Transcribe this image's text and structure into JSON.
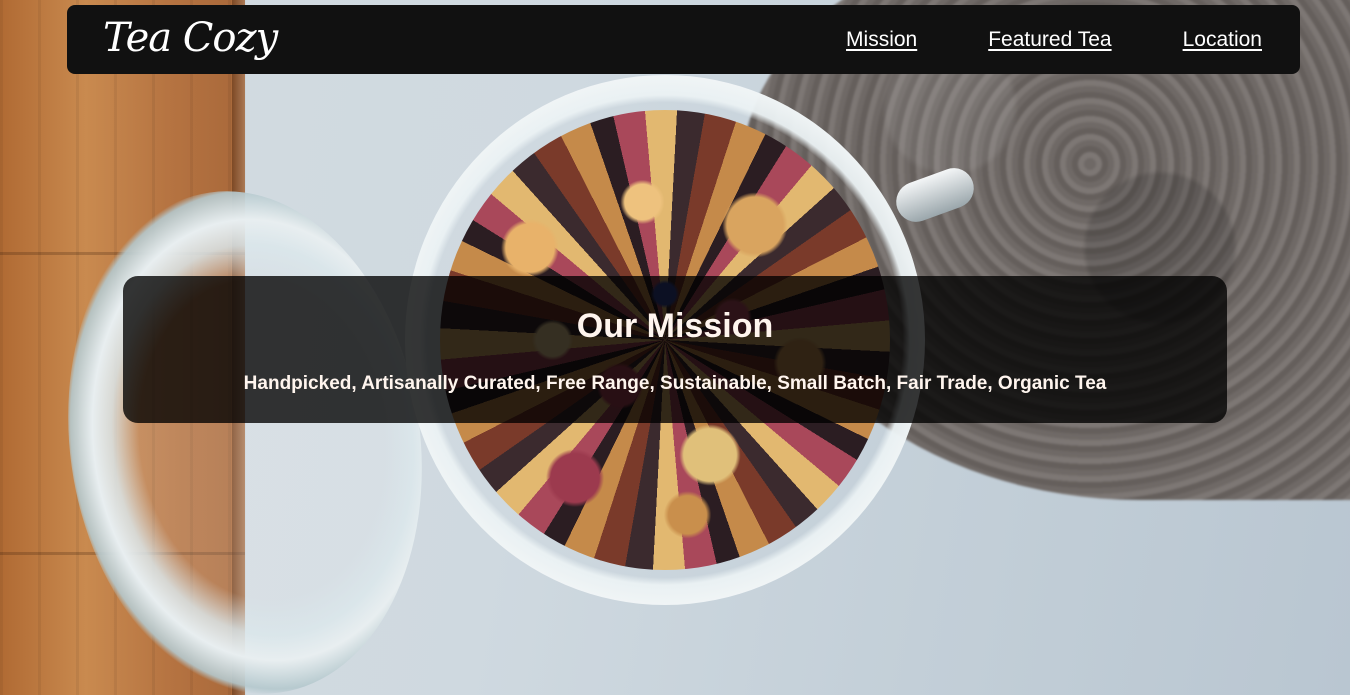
{
  "brand": {
    "name": "Tea Cozy"
  },
  "nav": {
    "links": [
      {
        "label": "Mission"
      },
      {
        "label": "Featured Tea"
      },
      {
        "label": "Location"
      }
    ]
  },
  "mission": {
    "title": "Our Mission",
    "subtitle": "Handpicked, Artisanally Curated, Free Range, Sustainable, Small Batch, Fair Trade, Organic Tea"
  },
  "colors": {
    "navbar_bg": "#111111",
    "nav_text": "#ffffff",
    "mission_bg": "rgba(0,0,0,0.78)",
    "mission_text": "#fff5ee"
  },
  "background_image": {
    "subject": "open glass jar of loose-leaf fruit tea on a light surface with wooden board and grey knit cloth"
  }
}
